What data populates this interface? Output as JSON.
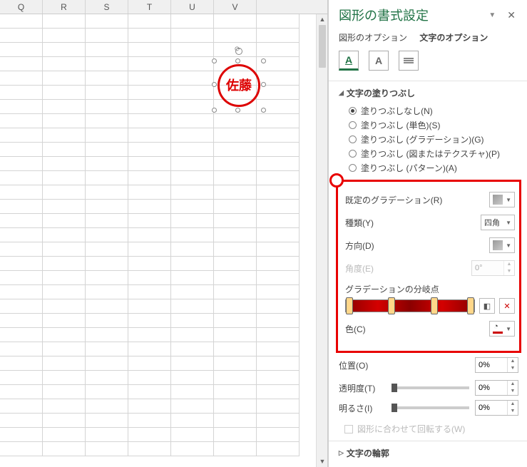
{
  "columns": [
    "Q",
    "R",
    "S",
    "T",
    "U",
    "V"
  ],
  "stamp_text": "佐藤",
  "pane": {
    "title": "図形の書式設定",
    "tab_shape": "図形のオプション",
    "tab_text": "文字のオプション"
  },
  "section_fill": {
    "title": "文字の塗りつぶし",
    "radios": {
      "none": "塗りつぶしなし(N)",
      "solid": "塗りつぶし (単色)(S)",
      "gradient": "塗りつぶし (グラデーション)(G)",
      "picture": "塗りつぶし (図またはテクスチャ)(P)",
      "pattern": "塗りつぶし (パターン)(A)"
    },
    "selected": "none"
  },
  "grad": {
    "preset": "既定のグラデーション(R)",
    "type_label": "種類(Y)",
    "type_value": "四角",
    "direction": "方向(D)",
    "angle_label": "角度(E)",
    "angle_value": "0°",
    "stops_label": "グラデーションの分岐点",
    "color_label": "色(C)"
  },
  "more": {
    "position_label": "位置(O)",
    "position_value": "0%",
    "transparency_label": "透明度(T)",
    "transparency_value": "0%",
    "brightness_label": "明るさ(I)",
    "brightness_value": "0%",
    "rotate_with_shape": "図形に合わせて回転する(W)"
  },
  "section_outline": "文字の輪郭"
}
